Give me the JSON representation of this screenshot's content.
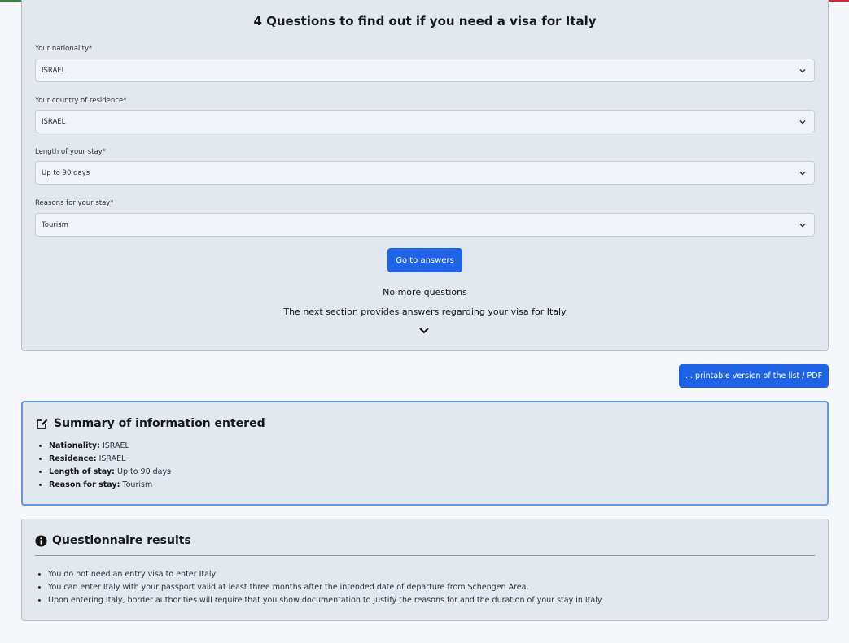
{
  "questions": {
    "title": "4 Questions to find out if you need a visa for Italy",
    "fields": [
      {
        "label": "Your nationality*",
        "value": "ISRAEL"
      },
      {
        "label": "Your country of residence*",
        "value": "ISRAEL"
      },
      {
        "label": "Length of your stay*",
        "value": "Up to 90 days"
      },
      {
        "label": "Reasons for your stay*",
        "value": "Tourism"
      }
    ],
    "go_button": "Go to answers",
    "no_more": "No more questions",
    "next_section": "The next section provides answers regarding your visa for Italy"
  },
  "pdf_button": "... printable version of the list / PDF",
  "summary": {
    "title": "Summary of information entered",
    "items": [
      {
        "key": "Nationality:",
        "value": "ISRAEL"
      },
      {
        "key": "Residence:",
        "value": "ISRAEL"
      },
      {
        "key": "Length of stay:",
        "value": "Up to 90 days"
      },
      {
        "key": "Reason for stay:",
        "value": "Tourism"
      }
    ]
  },
  "results": {
    "title": "Questionnaire results",
    "items": [
      "You do not need an entry visa to enter Italy",
      "You can enter Italy with your passport valid at least three months after the intended date of departure from Schengen Area.",
      "Upon entering Italy, border authorities will require that you show documentation to justify the reasons for and the duration of your stay in Italy."
    ]
  },
  "colors": {
    "accent": "#1f63e6",
    "card_bg": "#e3e8ef",
    "summary_border": "#5b9bea"
  },
  "icons": [
    "chevron-down-icon",
    "edit-icon",
    "info-icon"
  ]
}
